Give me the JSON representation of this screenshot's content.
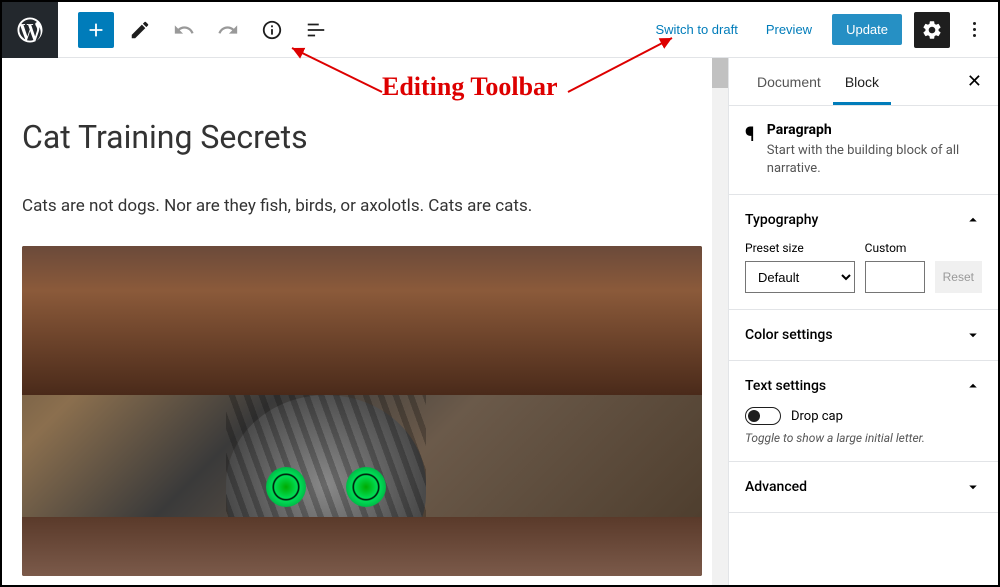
{
  "annotation": {
    "label": "Editing Toolbar"
  },
  "toolbar": {
    "switch_draft": "Switch to draft",
    "preview": "Preview",
    "update": "Update"
  },
  "editor": {
    "title": "Cat Training Secrets",
    "paragraph": "Cats are not dogs. Nor are they fish, birds, or axolotls. Cats are cats."
  },
  "sidebar": {
    "tabs": {
      "document": "Document",
      "block": "Block"
    },
    "block_info": {
      "name": "Paragraph",
      "description": "Start with the building block of all narrative."
    },
    "typography": {
      "title": "Typography",
      "preset_label": "Preset size",
      "preset_value": "Default",
      "custom_label": "Custom",
      "reset": "Reset"
    },
    "color": {
      "title": "Color settings"
    },
    "text": {
      "title": "Text settings",
      "dropcap_label": "Drop cap",
      "dropcap_hint": "Toggle to show a large initial letter."
    },
    "advanced": {
      "title": "Advanced"
    }
  }
}
